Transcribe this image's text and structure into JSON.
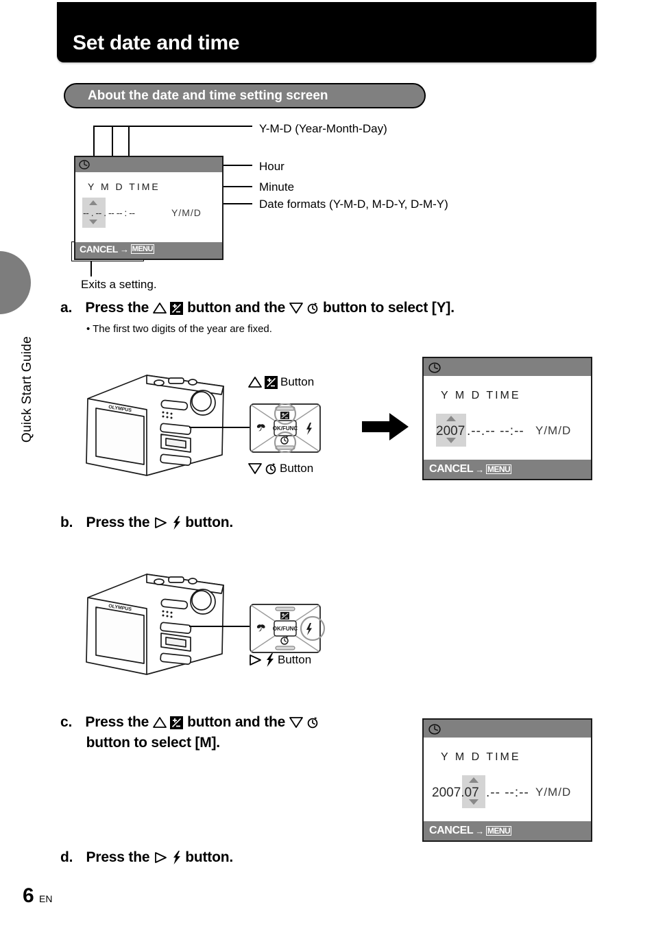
{
  "header": {
    "title": "Set date and time"
  },
  "section": {
    "title": "About the date and time setting screen"
  },
  "sidebar": {
    "guide_label": "Quick Start Guide"
  },
  "diagram": {
    "callouts": [
      {
        "id": "ymd",
        "label": "Y-M-D (Year-Month-Day)"
      },
      {
        "id": "hour",
        "label": "Hour"
      },
      {
        "id": "minute",
        "label": "Minute"
      },
      {
        "id": "formats",
        "label": "Date formats (Y-M-D, M-D-Y, D-M-Y)"
      }
    ],
    "exit_note": "Exits a setting.",
    "screen": {
      "clock_icon": "clock-icon",
      "column_header": "Y   M  D TIME",
      "value": "-- . -- . --  -- : --",
      "format": "Y/M/D",
      "cancel_label": "CANCEL",
      "cancel_arrow": "→",
      "menu_chip": "MENU"
    }
  },
  "steps": [
    {
      "id": "a",
      "marker": "a.",
      "text_part1": "Press the",
      "icon1": "up-triangle-icon",
      "icon2": "exposure-compensation-icon",
      "text_part2": "button and the",
      "icon3": "down-triangle-icon",
      "icon4": "self-timer-icon",
      "text_part3": "button to select [Y].",
      "bullet": "•  The first two digits of the year are fixed."
    },
    {
      "id": "b",
      "marker": "b.",
      "text_part1": "Press the",
      "icon1": "right-triangle-icon",
      "icon2": "flash-icon",
      "text_part2": "button."
    },
    {
      "id": "c",
      "marker": "c.",
      "text_part1": "Press the",
      "icon1": "up-triangle-icon",
      "icon2": "exposure-compensation-icon",
      "text_part2": "button and the",
      "icon3": "down-triangle-icon",
      "icon4": "self-timer-icon",
      "text_part3": "button to select [M]."
    },
    {
      "id": "d",
      "marker": "d.",
      "text_part1": "Press the",
      "icon1": "right-triangle-icon",
      "icon2": "flash-icon",
      "text_part2": "button."
    }
  ],
  "pad": {
    "center_label": "OK/FUNC",
    "top_icon": "exposure-compensation-icon",
    "bottom_icon": "self-timer-icon",
    "left_icon": "macro-flower-icon",
    "right_icon": "flash-icon"
  },
  "captions": {
    "up_button": "Button",
    "down_button": "Button",
    "right_button": "Button"
  },
  "camera": {
    "brand": "OLYMPUS"
  },
  "lcd_screen_a": {
    "clock_icon": "clock-icon",
    "column_header": "Y   M  D TIME",
    "year": "2007",
    "rest": ".--.--  --:--",
    "format": "Y/M/D",
    "cancel_label": "CANCEL",
    "cancel_arrow": "→",
    "menu_chip": "MENU"
  },
  "lcd_screen_c": {
    "clock_icon": "clock-icon",
    "column_header": "Y   M  D TIME",
    "year_month": "2007.07",
    "rest": ".--  --:--",
    "format": "Y/M/D",
    "cancel_label": "CANCEL",
    "cancel_arrow": "→",
    "menu_chip": "MENU"
  },
  "footer": {
    "page_number": "6",
    "language": "EN"
  },
  "colors": {
    "title_band": "#000000",
    "pill": "#808080",
    "lcd_bar": "#808080",
    "highlight": "#d4d4d4",
    "side_tab": "#7d7d7d"
  }
}
